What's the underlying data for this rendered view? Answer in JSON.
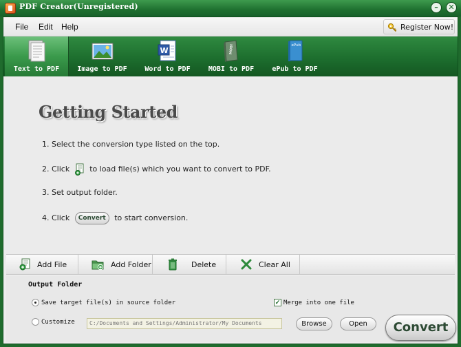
{
  "window": {
    "title": "PDF Creator(Unregistered)",
    "minimize": "–",
    "close": "✕"
  },
  "menu": {
    "file": "File",
    "edit": "Edit",
    "help": "Help",
    "register": "Register Now!"
  },
  "tabs": [
    {
      "label": "Text to PDF",
      "icon": "text-document-icon",
      "active": true
    },
    {
      "label": "Image to PDF",
      "icon": "image-icon",
      "active": false
    },
    {
      "label": "Word to PDF",
      "icon": "word-document-icon",
      "active": false
    },
    {
      "label": "MOBI to PDF",
      "icon": "mobi-book-icon",
      "active": false
    },
    {
      "label": "ePub to PDF",
      "icon": "epub-book-icon",
      "active": false
    }
  ],
  "getting_started": {
    "title": "Getting Started",
    "step1": "1. Select the conversion type listed on the top.",
    "step2_pre": "2. Click",
    "step2_post": "to load file(s) which you want to convert to PDF.",
    "step3": "3. Set output folder.",
    "step4_pre": "4. Click",
    "step4_button": "Convert",
    "step4_post": "to start conversion."
  },
  "toolbar": {
    "add_file": "Add File",
    "add_folder": "Add Folder",
    "delete": "Delete",
    "clear_all": "Clear All"
  },
  "output": {
    "title": "Output Folder",
    "save_source": "Save target file(s) in source folder",
    "save_source_selected": true,
    "customize": "Customize",
    "path": "C:/Documents and Settings/Administrator/My Documents",
    "merge": "Merge into one file",
    "merge_checked": true,
    "browse": "Browse",
    "open": "Open",
    "convert": "Convert"
  },
  "colors": {
    "brand_green": "#1f6b2d",
    "accent_green": "#3a9a4b"
  }
}
